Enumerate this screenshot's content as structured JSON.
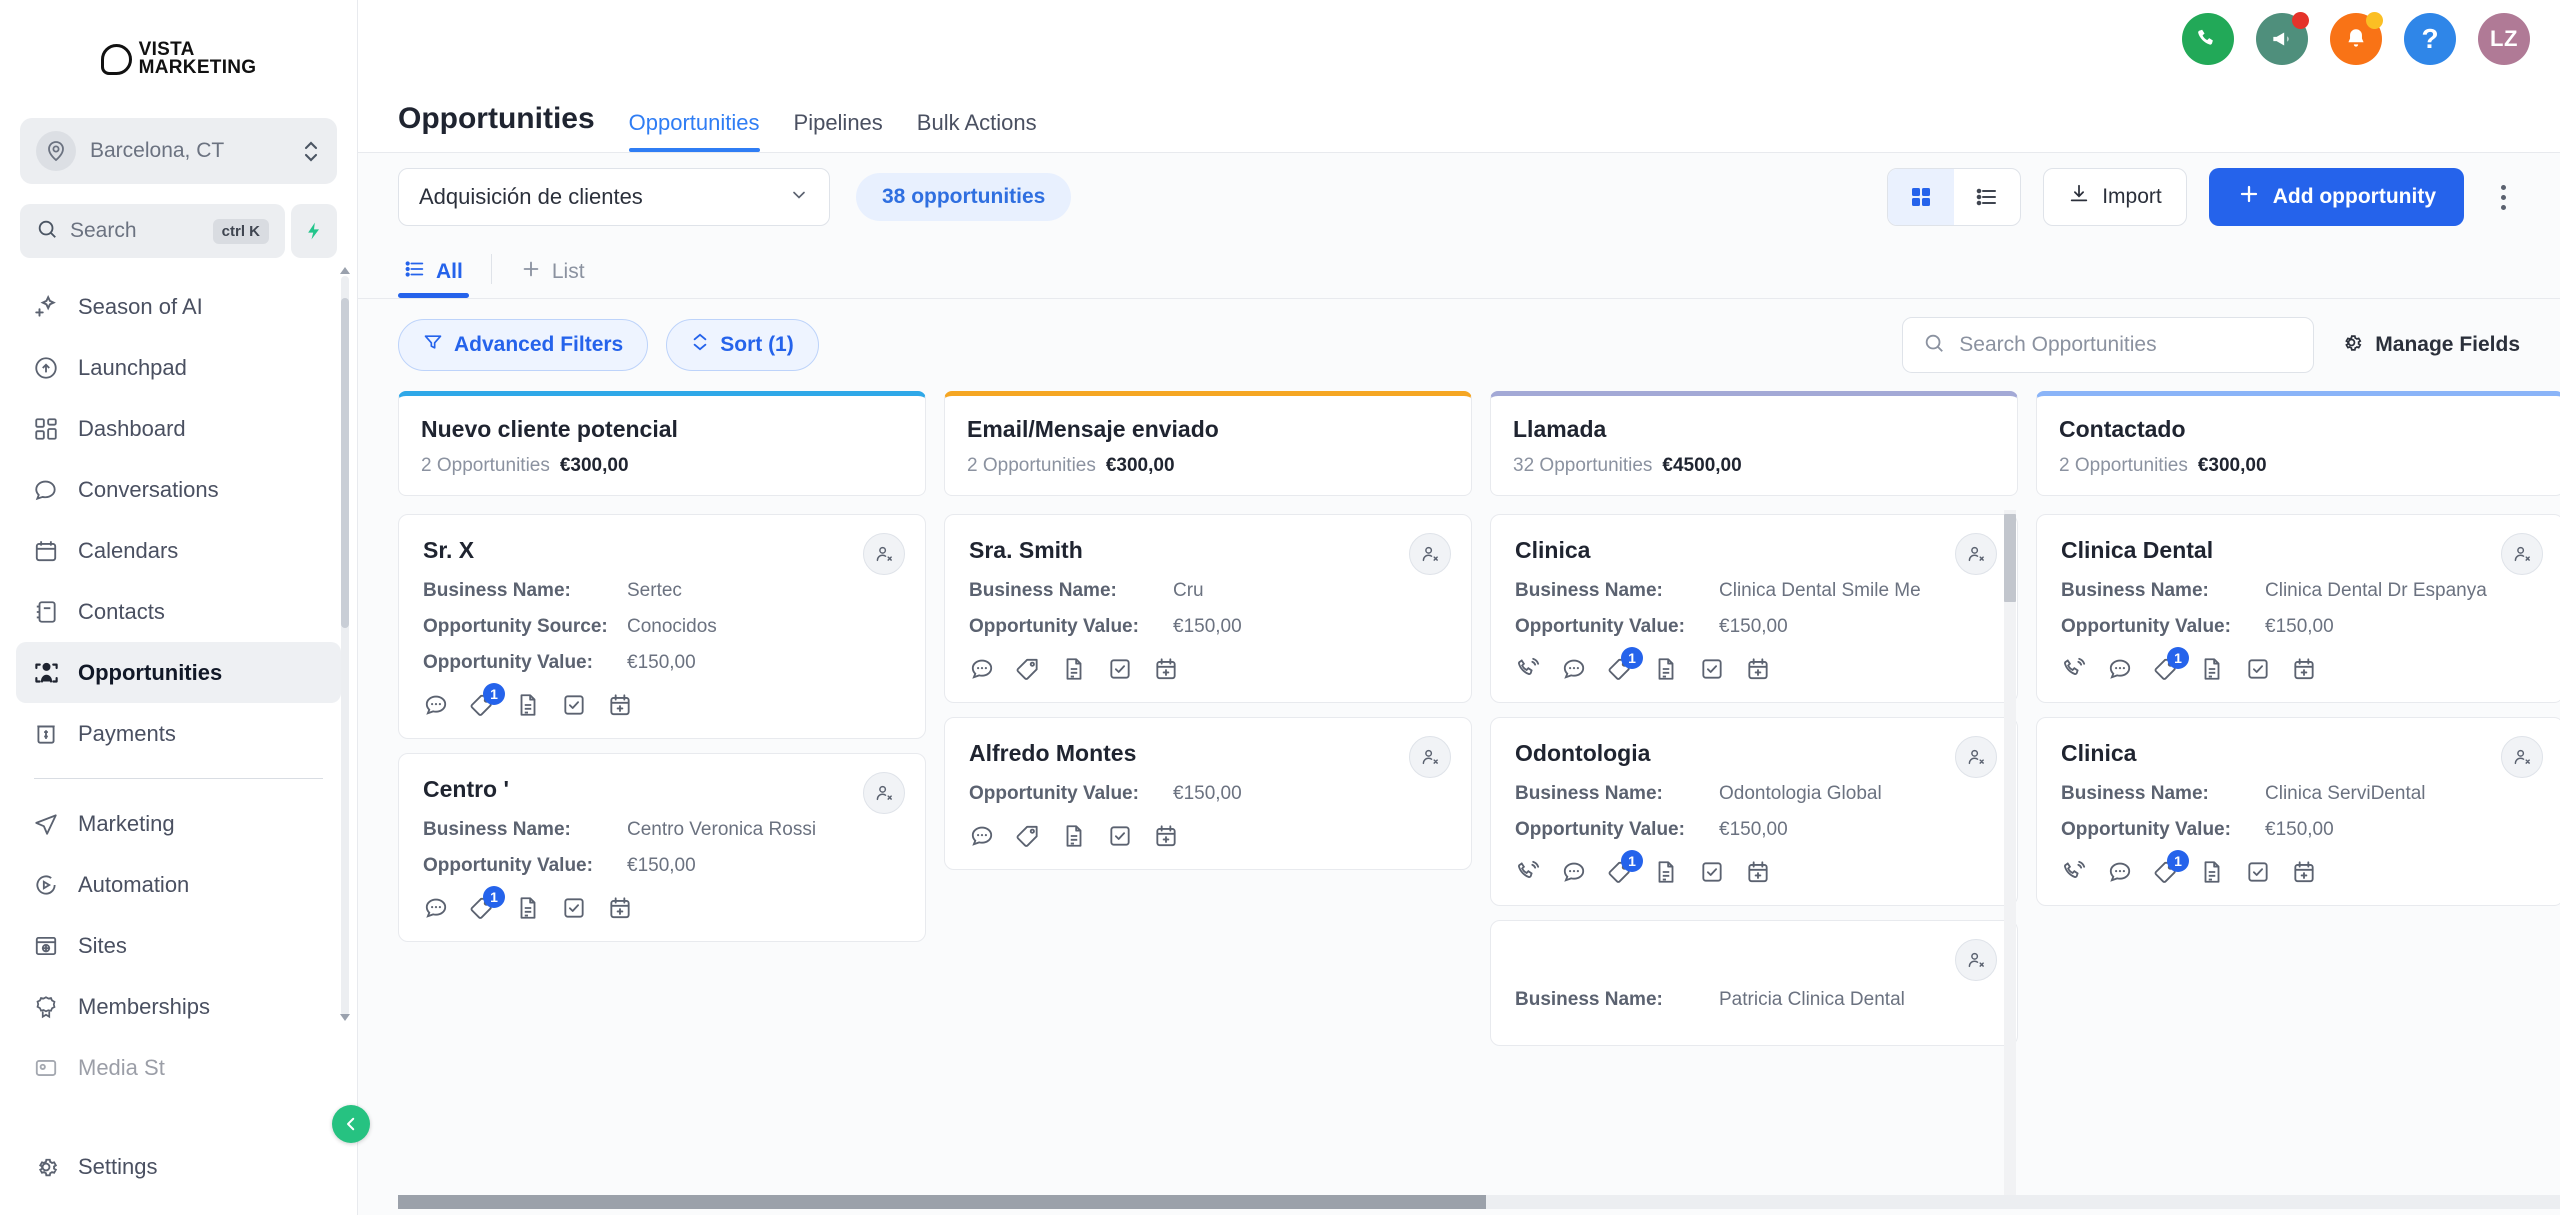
{
  "brand": {
    "line1": "VISTA",
    "line2": "MARKETING"
  },
  "location": {
    "name": "Barcelona, CT",
    "icon": "location-pin-icon"
  },
  "search": {
    "placeholder": "Search",
    "shortcut": "ctrl K",
    "icon": "search-icon",
    "bolt": "bolt-icon"
  },
  "sidebar": {
    "items": [
      {
        "label": "Season of AI",
        "icon": "sparkle-icon",
        "active": false
      },
      {
        "label": "Launchpad",
        "icon": "rocket-icon",
        "active": false
      },
      {
        "label": "Dashboard",
        "icon": "dashboard-icon",
        "active": false
      },
      {
        "label": "Conversations",
        "icon": "chat-bubble-icon",
        "active": false
      },
      {
        "label": "Calendars",
        "icon": "calendar-icon",
        "active": false
      },
      {
        "label": "Contacts",
        "icon": "contacts-book-icon",
        "active": false
      },
      {
        "label": "Opportunities",
        "icon": "opportunities-icon",
        "active": true
      },
      {
        "label": "Payments",
        "icon": "payments-icon",
        "active": false
      }
    ],
    "items2": [
      {
        "label": "Marketing",
        "icon": "paper-plane-icon",
        "active": false
      },
      {
        "label": "Automation",
        "icon": "automation-play-icon",
        "active": false
      },
      {
        "label": "Sites",
        "icon": "sites-icon",
        "active": false
      },
      {
        "label": "Memberships",
        "icon": "ribbon-badge-icon",
        "active": false
      },
      {
        "label": "Media St",
        "icon": "media-storage-icon",
        "active": false
      }
    ],
    "settings": {
      "label": "Settings",
      "icon": "gear-icon"
    },
    "collapse": "collapse-sidebar-icon"
  },
  "topbar": {
    "icons": [
      {
        "name": "phone-call-icon",
        "color": "#22a958",
        "glyph": "✆",
        "dot": null
      },
      {
        "name": "megaphone-icon",
        "color": "#4f8f7c",
        "glyph": "📣",
        "dot": "#e5332a"
      },
      {
        "name": "notification-bell-icon",
        "color": "#f97316",
        "glyph": "🔔",
        "dot": "#fbbf24"
      },
      {
        "name": "help-icon",
        "color": "#2f86e8",
        "glyph": "?",
        "dot": null
      }
    ],
    "avatar": {
      "initials": "LZ",
      "color": "#b07a96"
    }
  },
  "page": {
    "title": "Opportunities",
    "tabs": [
      {
        "label": "Opportunities",
        "active": true
      },
      {
        "label": "Pipelines",
        "active": false
      },
      {
        "label": "Bulk Actions",
        "active": false
      }
    ]
  },
  "toolbar": {
    "pipeline": "Adquisición de clientes",
    "count_pill": "38 opportunities",
    "view_grid": "grid-view-icon",
    "view_list": "list-view-icon",
    "import_label": "Import",
    "import_icon": "download-icon",
    "add_label": "Add opportunity",
    "add_icon": "plus-icon",
    "kebab": "more-options-icon"
  },
  "listbar": {
    "all_label": "All",
    "all_icon": "list-icon",
    "add_list_label": "List",
    "add_list_icon": "plus-icon"
  },
  "filters": {
    "advanced_label": "Advanced Filters",
    "advanced_icon": "filter-icon",
    "sort_label": "Sort (1)",
    "sort_icon": "sort-icon",
    "search_placeholder": "Search Opportunities",
    "search_icon": "search-icon",
    "manage_label": "Manage Fields",
    "manage_icon": "gear-icon"
  },
  "labels": {
    "business_name": "Business Name:",
    "opportunity_source": "Opportunity Source:",
    "opportunity_value": "Opportunity Value:",
    "remove_contact_icon": "remove-person-icon",
    "icons": {
      "call": "phone-outline-icon",
      "chat": "chat-bubble-icon",
      "tag": "tag-icon",
      "doc": "document-icon",
      "task": "task-check-icon",
      "calendar": "calendar-add-icon"
    }
  },
  "board": {
    "columns": [
      {
        "title": "Nuevo cliente potencial",
        "count": "2 Opportunities",
        "total": "€300,00",
        "accent": "#2fa8e8",
        "cards": [
          {
            "title": "Sr. X",
            "rows": [
              {
                "k": "Business Name:",
                "v": "Sertec"
              },
              {
                "k": "Opportunity Source:",
                "v": "Conocidos"
              },
              {
                "k": "Opportunity Value:",
                "v": "€150,00"
              }
            ],
            "icons": [
              "chat",
              "tag",
              "doc",
              "task",
              "calendar"
            ],
            "tag_badge": "1"
          },
          {
            "title": "Centro '",
            "rows": [
              {
                "k": "Business Name:",
                "v": "Centro Veronica Rossi"
              },
              {
                "k": "Opportunity Value:",
                "v": "€150,00"
              }
            ],
            "icons": [
              "chat",
              "tag",
              "doc",
              "task",
              "calendar"
            ],
            "tag_badge": "1"
          }
        ]
      },
      {
        "title": "Email/Mensaje enviado",
        "count": "2 Opportunities",
        "total": "€300,00",
        "accent": "#f5a623",
        "cards": [
          {
            "title": "Sra. Smith",
            "rows": [
              {
                "k": "Business Name:",
                "v": "Cru"
              },
              {
                "k": "Opportunity Value:",
                "v": "€150,00"
              }
            ],
            "icons": [
              "chat",
              "tag",
              "doc",
              "task",
              "calendar"
            ],
            "tag_badge": null
          },
          {
            "title": "Alfredo Montes",
            "rows": [
              {
                "k": "Opportunity Value:",
                "v": "€150,00"
              }
            ],
            "icons": [
              "chat",
              "tag",
              "doc",
              "task",
              "calendar"
            ],
            "tag_badge": null
          }
        ]
      },
      {
        "title": "Llamada",
        "count": "32 Opportunities",
        "total": "€4500,00",
        "accent": "#a3a9d6",
        "cards": [
          {
            "title": "Clinica",
            "rows": [
              {
                "k": "Business Name:",
                "v": "Clinica Dental Smile Me"
              },
              {
                "k": "Opportunity Value:",
                "v": "€150,00"
              }
            ],
            "icons": [
              "call",
              "chat",
              "tag",
              "doc",
              "task",
              "calendar"
            ],
            "tag_badge": "1"
          },
          {
            "title": "Odontologia",
            "rows": [
              {
                "k": "Business Name:",
                "v": "Odontologia Global"
              },
              {
                "k": "Opportunity Value:",
                "v": "€150,00"
              }
            ],
            "icons": [
              "call",
              "chat",
              "tag",
              "doc",
              "task",
              "calendar"
            ],
            "tag_badge": "1"
          },
          {
            "title": "",
            "rows": [
              {
                "k": "Business Name:",
                "v": "Patricia Clinica Dental"
              }
            ],
            "icons": [],
            "tag_badge": null
          }
        ]
      },
      {
        "title": "Contactado",
        "count": "2 Opportunities",
        "total": "€300,00",
        "accent": "#8ab4f8",
        "cards": [
          {
            "title": "Clinica Dental",
            "rows": [
              {
                "k": "Business Name:",
                "v": "Clinica Dental Dr Espanya"
              },
              {
                "k": "Opportunity Value:",
                "v": "€150,00"
              }
            ],
            "icons": [
              "call",
              "chat",
              "tag",
              "doc",
              "task",
              "calendar"
            ],
            "tag_badge": "1"
          },
          {
            "title": "Clinica",
            "rows": [
              {
                "k": "Business Name:",
                "v": "Clinica ServiDental"
              },
              {
                "k": "Opportunity Value:",
                "v": "€150,00"
              }
            ],
            "icons": [
              "call",
              "chat",
              "tag",
              "doc",
              "task",
              "calendar"
            ],
            "tag_badge": "1"
          }
        ]
      },
      {
        "title": "",
        "count": "",
        "total": "",
        "accent": "#c7cbd6",
        "cards": []
      }
    ]
  }
}
